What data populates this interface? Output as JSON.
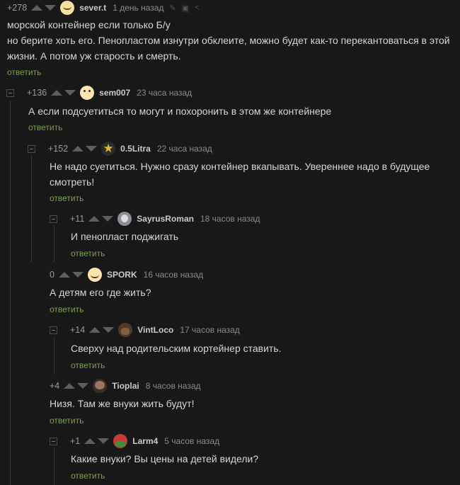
{
  "reply_label": "ответить",
  "comments": [
    {
      "rating": "+278",
      "author": "sever.t",
      "time": "1 день назад",
      "text": [
        "морской контейнер если только Б/у",
        "но берите хоть его.  Пенопластом изнутри обклеите, можно будет как-то перекантоваться в этой",
        "жизни. А потом уж старость и смерть."
      ],
      "avatar": "smiley-avatar"
    },
    {
      "rating": "+136",
      "author": "sem007",
      "time": "23 часа назад",
      "text": [
        "А если подсуетиться то могут и похоронить в этом же контейнере"
      ],
      "avatar": "smiley-avatar"
    },
    {
      "rating": "+152",
      "author": "0.5Litra",
      "time": "22 часа назад",
      "text": [
        "Не надо суетиться. Нужно сразу контейнер вкапывать. Увереннее надо в будущее",
        "смотреть!"
      ],
      "avatar": "star-avatar"
    },
    {
      "rating": "+11",
      "author": "SayrusRoman",
      "time": "18 часов назад",
      "text": [
        "И пенопласт поджигать"
      ],
      "avatar": "photo-avatar"
    },
    {
      "rating": "0",
      "author": "SPORK",
      "time": "16 часов назад",
      "text": [
        "А детям его где жить?"
      ],
      "avatar": "smiley-avatar"
    },
    {
      "rating": "+14",
      "author": "VintLoco",
      "time": "17 часов назад",
      "text": [
        "Сверху над родительским кортейнер ставить."
      ],
      "avatar": "photo-avatar"
    },
    {
      "rating": "+4",
      "author": "Tioplai",
      "time": "8 часов назад",
      "text": [
        "Низя. Там же внуки жить будут!"
      ],
      "avatar": "photo-avatar"
    },
    {
      "rating": "+1",
      "author": "Larm4",
      "time": "5 часов назад",
      "text": [
        "Какие внуки? Вы цены на детей видели?"
      ],
      "avatar": "cartoon-avatar"
    }
  ],
  "colors": {
    "background": "#181818",
    "reply": "#7aa43c",
    "thread_line": "#3a3a3a"
  }
}
